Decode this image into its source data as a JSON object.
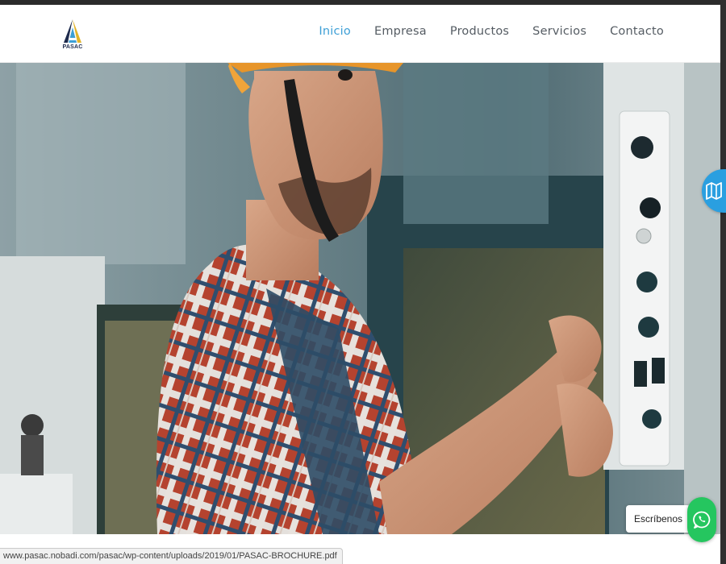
{
  "brand": {
    "logo_text": "PASAC",
    "logo_colors": [
      "#1e2b4d",
      "#3d9fd6",
      "#e3b52b"
    ]
  },
  "nav": {
    "items": [
      {
        "label": "Inicio",
        "active": true
      },
      {
        "label": "Empresa",
        "active": false
      },
      {
        "label": "Productos",
        "active": false
      },
      {
        "label": "Servicios",
        "active": false
      },
      {
        "label": "Contacto",
        "active": false
      }
    ],
    "active_color": "#3d9fd6",
    "text_color": "#555c63"
  },
  "hero": {
    "image": "worker-in-plaid-shirt-operating-control-panel"
  },
  "floating": {
    "map_icon": "map-icon",
    "whatsapp_label": "Escríbenos",
    "whatsapp_icon": "whatsapp-icon",
    "whatsapp_color": "#25c65f",
    "map_color": "#2a9fe0"
  },
  "status_bar": {
    "url": "www.pasac.nobadi.com/pasac/wp-content/uploads/2019/01/PASAC-BROCHURE.pdf"
  }
}
